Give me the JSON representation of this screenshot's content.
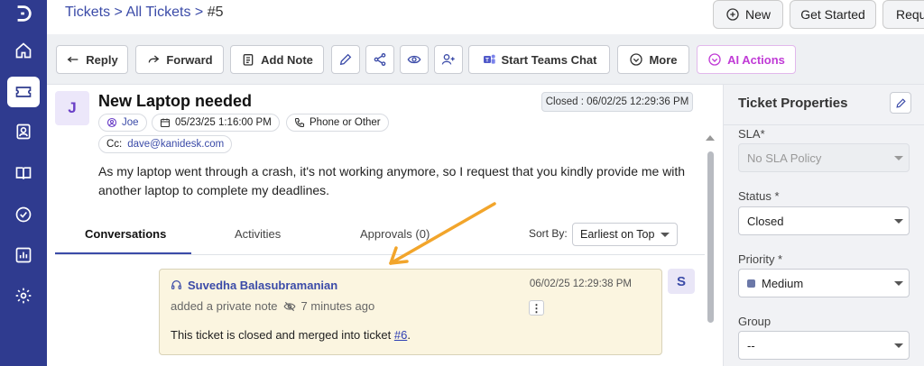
{
  "header": {
    "breadcrumb": {
      "tickets": "Tickets",
      "sep1": " > ",
      "all_tickets": "All Tickets",
      "sep2": " > ",
      "current": "#5"
    },
    "new_label": "New",
    "get_started_label": "Get Started",
    "requests_label": "Requ"
  },
  "toolbar": {
    "reply": "Reply",
    "forward": "Forward",
    "add_note": "Add Note",
    "start_teams_chat": "Start Teams Chat",
    "more": "More",
    "ai_actions": "AI Actions"
  },
  "ticket": {
    "avatar_letter": "J",
    "subject": "New Laptop needed",
    "closed": "Closed : 06/02/25 12:29:36 PM",
    "requester": "Joe",
    "created": "05/23/25 1:16:00 PM",
    "source": "Phone or Other",
    "cc_label": "Cc:",
    "cc_value": "dave@kanidesk.com",
    "description": "As my laptop went through a crash, it's not working anymore, so I request that you kindly provide me with another laptop to complete my deadlines."
  },
  "tabs": {
    "conversations": "Conversations",
    "activities": "Activities",
    "approvals": "Approvals (0)",
    "sort_by_label": "Sort By:",
    "sort_value": "Earliest on Top"
  },
  "note": {
    "author": "Suvedha Balasubramanian",
    "timestamp": "06/02/25 12:29:38 PM",
    "meta_prefix": "added a private note",
    "meta_time": "7 minutes ago",
    "body_text": "This ticket is closed and merged into ticket ",
    "link_text": "#6",
    "body_end": ".",
    "avatar_letter": "S",
    "menu_glyph": "⋮"
  },
  "properties": {
    "title": "Ticket Properties",
    "sla_label": "SLA*",
    "sla_value": "No SLA Policy",
    "status_label": "Status *",
    "status_value": "Closed",
    "priority_label": "Priority *",
    "priority_value": "Medium",
    "group_label": "Group",
    "group_value": "--"
  },
  "colors": {
    "sidebar": "#2f3b8f",
    "accent": "#3b4ba8",
    "ai": "#c03ad6",
    "note_bg": "#fbf5e0",
    "arrow": "#f2a52b"
  },
  "icons": [
    "logo-icon",
    "home-icon",
    "ticket-icon",
    "contacts-icon",
    "knowledge-icon",
    "tasks-icon",
    "reports-icon",
    "settings-icon"
  ]
}
